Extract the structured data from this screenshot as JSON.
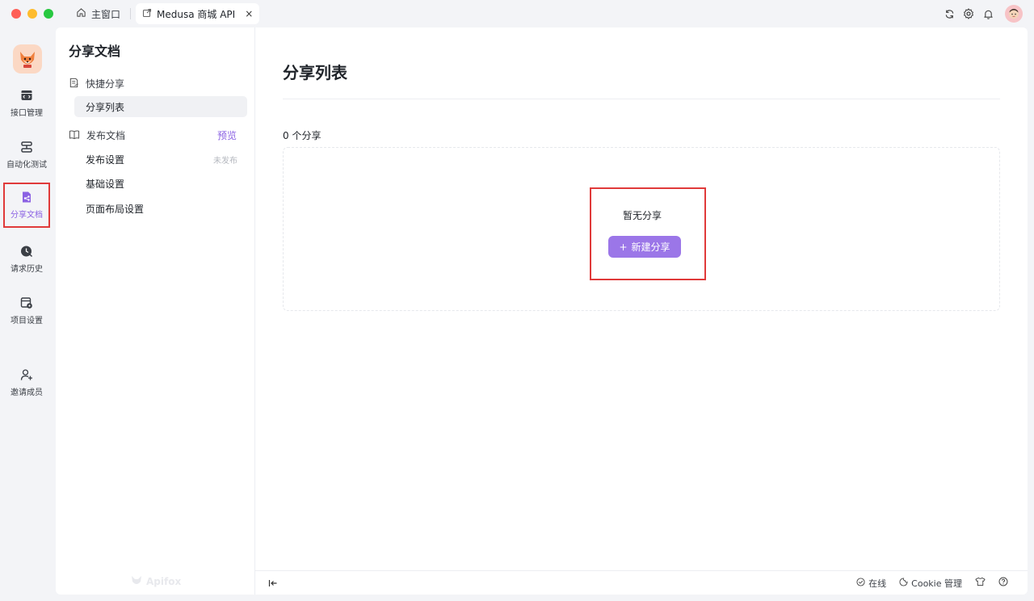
{
  "titlebar": {
    "home_tab": "主窗口",
    "active_tab": "Medusa 商城 API",
    "close_glyph": "×"
  },
  "rail": {
    "items": [
      {
        "label": "接口管理",
        "icon": "api-icon"
      },
      {
        "label": "自动化测试",
        "icon": "automation-icon"
      },
      {
        "label": "分享文档",
        "icon": "share-doc-icon",
        "active": true
      },
      {
        "label": "请求历史",
        "icon": "history-icon"
      },
      {
        "label": "项目设置",
        "icon": "project-settings-icon"
      },
      {
        "label": "邀请成员",
        "icon": "invite-member-icon"
      }
    ]
  },
  "sub_panel": {
    "title": "分享文档",
    "quick_share_group": "快捷分享",
    "share_list_item": "分享列表",
    "publish_group": "发布文档",
    "preview_link": "预览",
    "publish_settings": "发布设置",
    "publish_status": "未发布",
    "basic_settings": "基础设置",
    "layout_settings": "页面布局设置",
    "brand": "Apifox"
  },
  "main": {
    "title": "分享列表",
    "count_label": "0 个分享",
    "empty_text": "暂无分享",
    "new_button": "新建分享",
    "new_button_icon": "+"
  },
  "statusbar": {
    "online": "在线",
    "cookie": "Cookie 管理"
  },
  "colors": {
    "accent": "#9b76e8",
    "accent_text": "#8b62e3",
    "highlight": "#e03a3a"
  }
}
